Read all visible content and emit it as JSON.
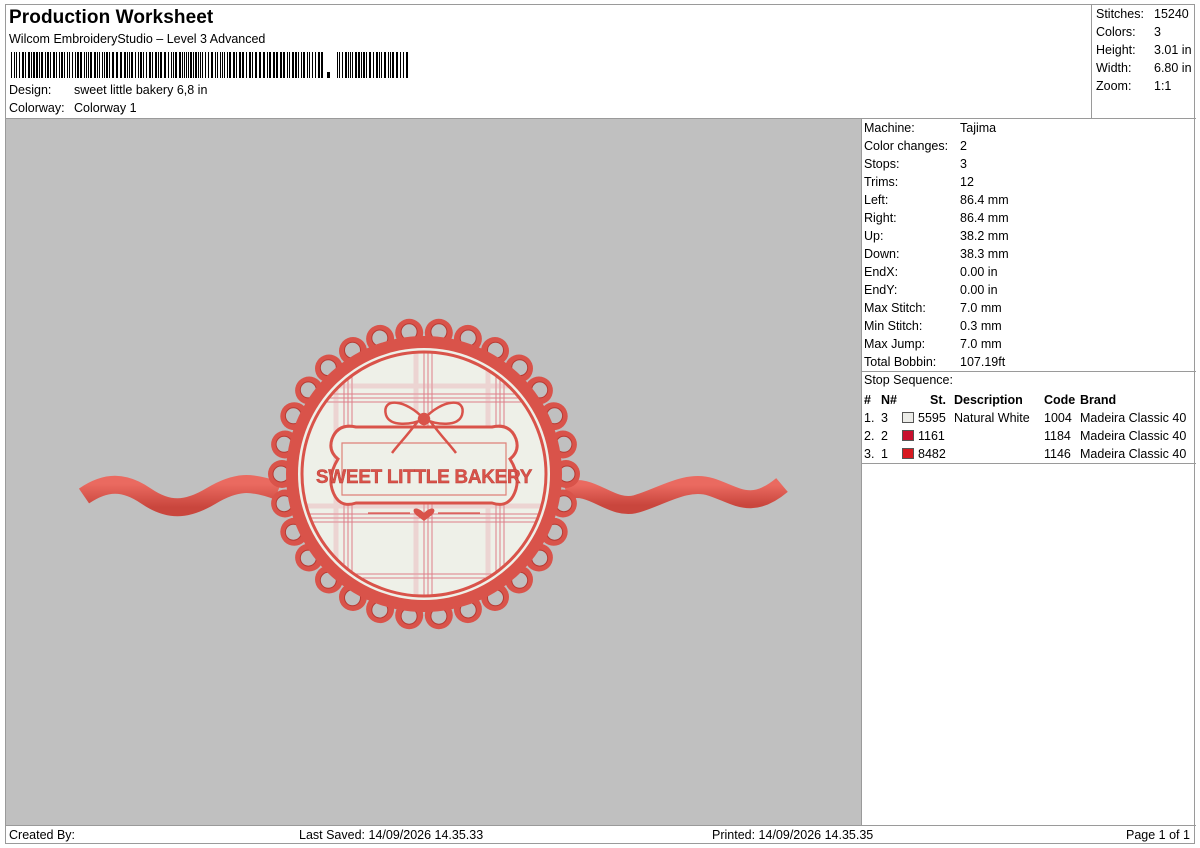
{
  "header": {
    "title": "Production Worksheet",
    "subtitle": "Wilcom EmbroideryStudio – Level 3 Advanced",
    "design_label": "Design:",
    "design_value": "sweet little bakery 6,8 in",
    "colorway_label": "Colorway:",
    "colorway_value": "Colorway 1"
  },
  "stats": {
    "stitches_label": "Stitches:",
    "stitches": "15240",
    "colors_label": "Colors:",
    "colors": "3",
    "height_label": "Height:",
    "height": "3.01 in",
    "width_label": "Width:",
    "width": "6.80 in",
    "zoom_label": "Zoom:",
    "zoom": "1:1"
  },
  "machine": {
    "rows": [
      {
        "label": "Machine:",
        "value": "Tajima"
      },
      {
        "label": "Color changes:",
        "value": "2"
      },
      {
        "label": "Stops:",
        "value": "3"
      },
      {
        "label": "Trims:",
        "value": "12"
      },
      {
        "label": "Left:",
        "value": "86.4 mm"
      },
      {
        "label": "Right:",
        "value": "86.4 mm"
      },
      {
        "label": "Up:",
        "value": "38.2 mm"
      },
      {
        "label": "Down:",
        "value": "38.3 mm"
      },
      {
        "label": "EndX:",
        "value": "0.00 in"
      },
      {
        "label": "EndY:",
        "value": "0.00 in"
      },
      {
        "label": "Max Stitch:",
        "value": "7.0 mm"
      },
      {
        "label": "Min Stitch:",
        "value": "0.3 mm"
      },
      {
        "label": "Max Jump:",
        "value": "7.0 mm"
      },
      {
        "label": "Total Bobbin:",
        "value": "107.19ft"
      }
    ]
  },
  "stop_sequence": {
    "heading": "Stop Sequence:",
    "columns": [
      "#",
      "N#",
      "St.",
      "Description",
      "Code",
      "Brand"
    ],
    "rows": [
      {
        "index": "1.",
        "n": "3",
        "swatch": "#ecece8",
        "stitches": "5595",
        "description": "Natural White",
        "code": "1004",
        "brand": "Madeira Classic 40"
      },
      {
        "index": "2.",
        "n": "2",
        "swatch": "#c8102e",
        "stitches": "1161",
        "description": "",
        "code": "1184",
        "brand": "Madeira Classic 40"
      },
      {
        "index": "3.",
        "n": "1",
        "swatch": "#d71920",
        "stitches": "8482",
        "description": "",
        "code": "1146",
        "brand": "Madeira Classic 40"
      }
    ]
  },
  "design": {
    "text": "SWEET LITTLE BAKERY",
    "colors": {
      "ribbon": "#e0584e",
      "ribbon_dark": "#b83a33",
      "fill": "#eef0e8",
      "plaid": "#d9586a",
      "canvas": "#c0c0c0"
    }
  },
  "footer": {
    "created_by": "Created By:",
    "last_saved": "Last Saved: 14/09/2026 14.35.33",
    "printed": "Printed: 14/09/2026 14.35.35",
    "page": "Page 1 of 1"
  }
}
